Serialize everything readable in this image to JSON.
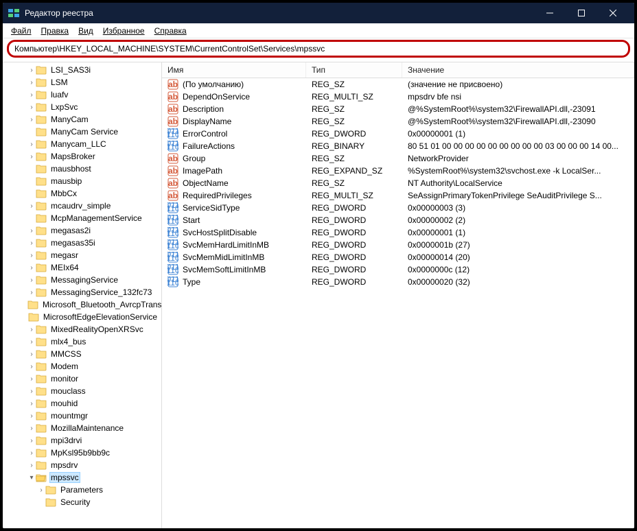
{
  "title": "Редактор реестра",
  "menu": {
    "file": "Файл",
    "edit": "Правка",
    "view": "Вид",
    "fav": "Избранное",
    "help": "Справка"
  },
  "address": "Компьютер\\HKEY_LOCAL_MACHINE\\SYSTEM\\CurrentControlSet\\Services\\mpssvc",
  "headers": {
    "name": "Имя",
    "type": "Тип",
    "value": "Значение"
  },
  "tree": [
    {
      "ind": 2,
      "chev": ">",
      "open": false,
      "label": "LSI_SAS3i"
    },
    {
      "ind": 2,
      "chev": ">",
      "open": false,
      "label": "LSM"
    },
    {
      "ind": 2,
      "chev": ">",
      "open": false,
      "label": "luafv"
    },
    {
      "ind": 2,
      "chev": ">",
      "open": false,
      "label": "LxpSvc"
    },
    {
      "ind": 2,
      "chev": ">",
      "open": false,
      "label": "ManyCam"
    },
    {
      "ind": 2,
      "chev": "",
      "open": false,
      "label": "ManyCam Service"
    },
    {
      "ind": 2,
      "chev": ">",
      "open": false,
      "label": "Manycam_LLC"
    },
    {
      "ind": 2,
      "chev": ">",
      "open": false,
      "label": "MapsBroker"
    },
    {
      "ind": 2,
      "chev": "",
      "open": false,
      "label": "mausbhost"
    },
    {
      "ind": 2,
      "chev": "",
      "open": false,
      "label": "mausbip"
    },
    {
      "ind": 2,
      "chev": "",
      "open": false,
      "label": "MbbCx"
    },
    {
      "ind": 2,
      "chev": ">",
      "open": false,
      "label": "mcaudrv_simple"
    },
    {
      "ind": 2,
      "chev": "",
      "open": false,
      "label": "McpManagementService"
    },
    {
      "ind": 2,
      "chev": ">",
      "open": false,
      "label": "megasas2i"
    },
    {
      "ind": 2,
      "chev": ">",
      "open": false,
      "label": "megasas35i"
    },
    {
      "ind": 2,
      "chev": ">",
      "open": false,
      "label": "megasr"
    },
    {
      "ind": 2,
      "chev": ">",
      "open": false,
      "label": "MEIx64"
    },
    {
      "ind": 2,
      "chev": ">",
      "open": false,
      "label": "MessagingService"
    },
    {
      "ind": 2,
      "chev": ">",
      "open": false,
      "label": "MessagingService_132fc73"
    },
    {
      "ind": 2,
      "chev": "",
      "open": false,
      "label": "Microsoft_Bluetooth_AvrcpTransport"
    },
    {
      "ind": 2,
      "chev": "",
      "open": false,
      "label": "MicrosoftEdgeElevationService"
    },
    {
      "ind": 2,
      "chev": ">",
      "open": false,
      "label": "MixedRealityOpenXRSvc"
    },
    {
      "ind": 2,
      "chev": ">",
      "open": false,
      "label": "mlx4_bus"
    },
    {
      "ind": 2,
      "chev": ">",
      "open": false,
      "label": "MMCSS"
    },
    {
      "ind": 2,
      "chev": ">",
      "open": false,
      "label": "Modem"
    },
    {
      "ind": 2,
      "chev": ">",
      "open": false,
      "label": "monitor"
    },
    {
      "ind": 2,
      "chev": ">",
      "open": false,
      "label": "mouclass"
    },
    {
      "ind": 2,
      "chev": ">",
      "open": false,
      "label": "mouhid"
    },
    {
      "ind": 2,
      "chev": ">",
      "open": false,
      "label": "mountmgr"
    },
    {
      "ind": 2,
      "chev": ">",
      "open": false,
      "label": "MozillaMaintenance"
    },
    {
      "ind": 2,
      "chev": ">",
      "open": false,
      "label": "mpi3drvi"
    },
    {
      "ind": 2,
      "chev": ">",
      "open": false,
      "label": "MpKsl95b9bb9c"
    },
    {
      "ind": 2,
      "chev": ">",
      "open": false,
      "label": "mpsdrv"
    },
    {
      "ind": 2,
      "chev": "v",
      "open": true,
      "label": "mpssvc",
      "selected": true
    },
    {
      "ind": 3,
      "chev": ">",
      "open": false,
      "label": "Parameters"
    },
    {
      "ind": 3,
      "chev": "",
      "open": false,
      "label": "Security"
    }
  ],
  "values": [
    {
      "icon": "sz",
      "name": "(По умолчанию)",
      "type": "REG_SZ",
      "value": "(значение не присвоено)"
    },
    {
      "icon": "sz",
      "name": "DependOnService",
      "type": "REG_MULTI_SZ",
      "value": "mpsdrv bfe nsi"
    },
    {
      "icon": "sz",
      "name": "Description",
      "type": "REG_SZ",
      "value": "@%SystemRoot%\\system32\\FirewallAPI.dll,-23091"
    },
    {
      "icon": "sz",
      "name": "DisplayName",
      "type": "REG_SZ",
      "value": "@%SystemRoot%\\system32\\FirewallAPI.dll,-23090"
    },
    {
      "icon": "bin",
      "name": "ErrorControl",
      "type": "REG_DWORD",
      "value": "0x00000001 (1)"
    },
    {
      "icon": "bin",
      "name": "FailureActions",
      "type": "REG_BINARY",
      "value": "80 51 01 00 00 00 00 00 00 00 00 00 03 00 00 00 14 00..."
    },
    {
      "icon": "sz",
      "name": "Group",
      "type": "REG_SZ",
      "value": "NetworkProvider"
    },
    {
      "icon": "sz",
      "name": "ImagePath",
      "type": "REG_EXPAND_SZ",
      "value": "%SystemRoot%\\system32\\svchost.exe -k LocalSer..."
    },
    {
      "icon": "sz",
      "name": "ObjectName",
      "type": "REG_SZ",
      "value": "NT Authority\\LocalService"
    },
    {
      "icon": "sz",
      "name": "RequiredPrivileges",
      "type": "REG_MULTI_SZ",
      "value": "SeAssignPrimaryTokenPrivilege SeAuditPrivilege S..."
    },
    {
      "icon": "bin",
      "name": "ServiceSidType",
      "type": "REG_DWORD",
      "value": "0x00000003 (3)"
    },
    {
      "icon": "bin",
      "name": "Start",
      "type": "REG_DWORD",
      "value": "0x00000002 (2)"
    },
    {
      "icon": "bin",
      "name": "SvcHostSplitDisable",
      "type": "REG_DWORD",
      "value": "0x00000001 (1)"
    },
    {
      "icon": "bin",
      "name": "SvcMemHardLimitInMB",
      "type": "REG_DWORD",
      "value": "0x0000001b (27)"
    },
    {
      "icon": "bin",
      "name": "SvcMemMidLimitInMB",
      "type": "REG_DWORD",
      "value": "0x00000014 (20)"
    },
    {
      "icon": "bin",
      "name": "SvcMemSoftLimitInMB",
      "type": "REG_DWORD",
      "value": "0x0000000c (12)"
    },
    {
      "icon": "bin",
      "name": "Type",
      "type": "REG_DWORD",
      "value": "0x00000020 (32)"
    }
  ]
}
